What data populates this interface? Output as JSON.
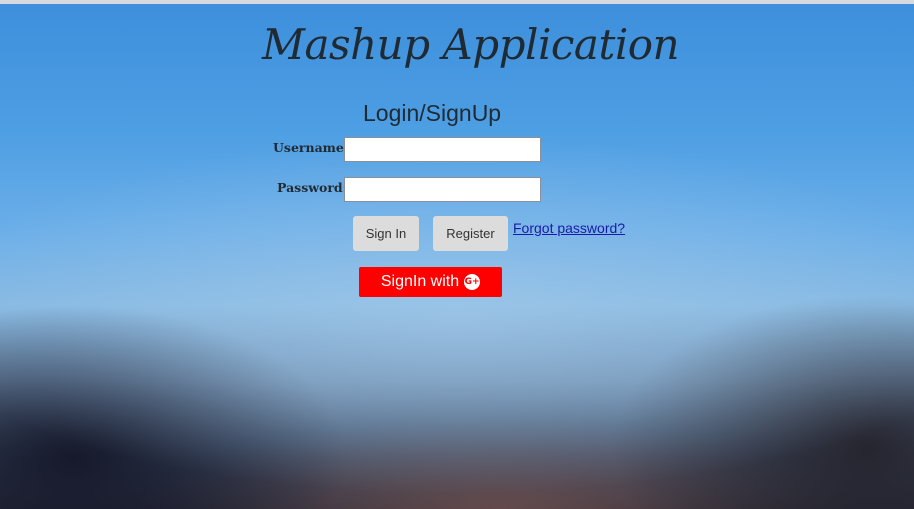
{
  "app": {
    "title": "Mashup Application",
    "subtitle": "Login/SignUp"
  },
  "form": {
    "username_label": "Username:",
    "password_label": "Password:",
    "username_value": "",
    "password_value": ""
  },
  "buttons": {
    "sign_in": "Sign In",
    "register": "Register",
    "forgot_password": "Forgot password?",
    "google_signin": "SignIn with",
    "google_icon_text": "G+"
  },
  "icons": {
    "google": "google-plus-icon"
  },
  "colors": {
    "google_button": "#ff0000",
    "link": "#1a1aa6"
  }
}
